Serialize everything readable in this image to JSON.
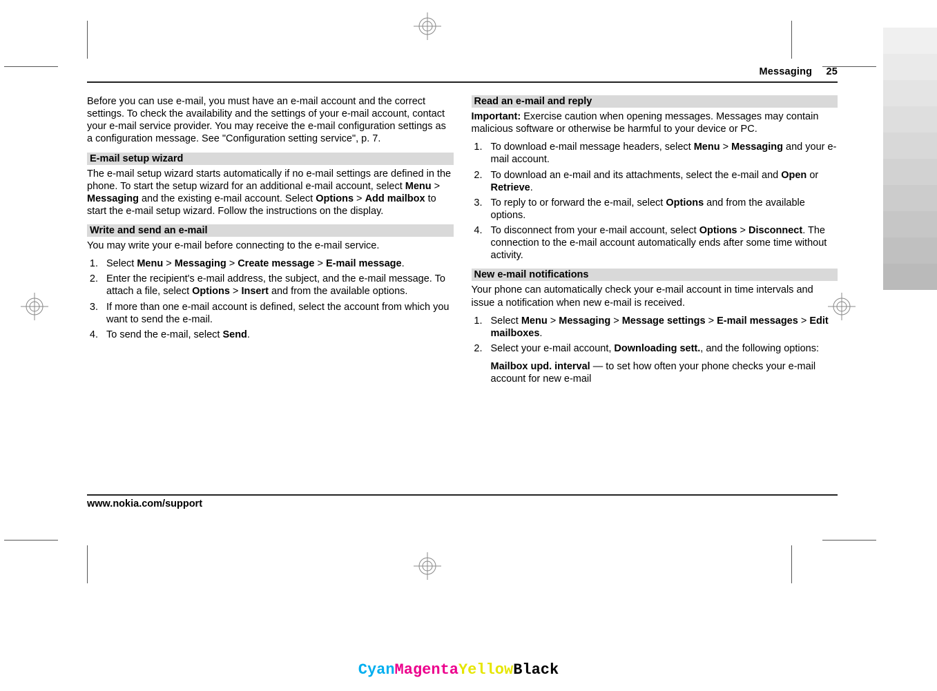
{
  "header": {
    "section": "Messaging",
    "page": "25"
  },
  "col1": {
    "intro": "Before you can use e-mail, you must have an e-mail account and the correct settings. To check the availability and the settings of your e-mail account, contact your e-mail service provider. You may receive the e-mail configuration settings as a configuration message. See \"Configuration setting service\", p. 7.",
    "sec1_title": "E-mail setup wizard",
    "sec1_p1a": "The e-mail setup wizard starts automatically if no e-mail settings are defined in the phone. To start the setup wizard for an additional e-mail account, select ",
    "menu": "Menu",
    "gt": " > ",
    "messaging": "Messaging",
    "sec1_p1b": " and the existing e-mail account. Select ",
    "options": "Options",
    "addmailbox": "Add mailbox",
    "sec1_p1c": " to start the e-mail setup wizard. Follow the instructions on the display.",
    "sec2_title": "Write and send an e-mail",
    "sec2_intro": "You may write your e-mail before connecting to the e-mail service.",
    "li1a": "Select ",
    "createmsg": "Create message",
    "emailmsg": "E-mail message",
    "li1b": ".",
    "li2a": "Enter the recipient's e-mail address, the subject, and the e-mail message. To attach a file, select ",
    "insert": "Insert",
    "li2b": " and from the available options.",
    "li3": "If more than one e-mail account is defined, select the account from which you want to send the e-mail.",
    "li4a": "To send the e-mail, select ",
    "send": "Send",
    "li4b": "."
  },
  "col2": {
    "sec3_title": "Read an e-mail and reply",
    "imp_label": "Important:",
    "imp_text": "  Exercise caution when opening messages. Messages may contain malicious software or otherwise be harmful to your device or PC.",
    "r1a": "To download e-mail message headers, select ",
    "r1b": " and your e-mail account.",
    "r2a": "To download an e-mail and its attachments, select the e-mail and ",
    "open": "Open",
    "or": " or ",
    "retrieve": "Retrieve",
    "r2b": ".",
    "r3a": "To reply to or forward the e-mail, select ",
    "r3b": " and from the available options.",
    "r4a": "To disconnect from your e-mail account, select ",
    "disconnect": "Disconnect",
    "r4b": ". The connection to the e-mail account automatically ends after some time without activity.",
    "sec4_title": "New e-mail notifications",
    "sec4_intro": "Your phone can automatically check your e-mail account in time intervals and issue a notification when new e-mail is received.",
    "n1a": "Select ",
    "msgsettings": "Message settings",
    "emailmsgs": "E-mail messages",
    "editmb": "Edit mailboxes",
    "n1b": ".",
    "n2a": "Select your e-mail account, ",
    "dlsett": "Downloading sett.",
    "n2b": ", and the following options:",
    "opt1_label": "Mailbox upd. interval",
    "opt1_text": "  — to set how often your phone checks your e-mail account for new e-mail"
  },
  "footer": "www.nokia.com/support",
  "cmyk": {
    "c": "Cyan",
    "m": "Magenta",
    "y": "Yellow",
    "k": "Black"
  }
}
